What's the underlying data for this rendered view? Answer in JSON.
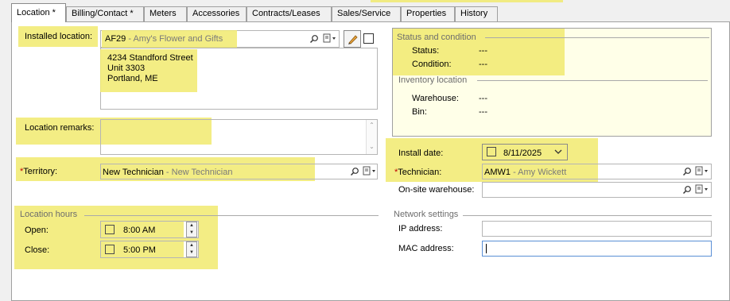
{
  "tabs": [
    {
      "label": "Location *"
    },
    {
      "label": "Billing/Contact *"
    },
    {
      "label": "Meters"
    },
    {
      "label": "Accessories"
    },
    {
      "label": "Contracts/Leases"
    },
    {
      "label": "Sales/Service"
    },
    {
      "label": "Properties"
    },
    {
      "label": "History"
    }
  ],
  "location": {
    "installed_label": "Installed location:",
    "code": "AF29",
    "name": "- Amy's Flower and Gifts",
    "address": [
      "4234 Standford Street",
      "Unit 3303",
      "Portland, ME"
    ],
    "remarks_label": "Location remarks:",
    "territory_label": "Territory:",
    "territory_code": "New Technician",
    "territory_name": "- New Technician",
    "hours_title": "Location hours",
    "open_label": "Open:",
    "open_value": "8:00 AM",
    "close_label": "Close:",
    "close_value": "5:00 PM"
  },
  "status": {
    "title": "Status and condition",
    "status_label": "Status:",
    "status_value": "---",
    "condition_label": "Condition:",
    "condition_value": "---",
    "inventory_title": "Inventory location",
    "warehouse_label": "Warehouse:",
    "warehouse_value": "---",
    "bin_label": "Bin:",
    "bin_value": "---"
  },
  "install": {
    "date_label": "Install date:",
    "date_value": "8/11/2025",
    "tech_label": "Technician:",
    "tech_code": "AMW1",
    "tech_name": "- Amy Wickett",
    "onsite_label": "On-site warehouse:"
  },
  "network": {
    "title": "Network settings",
    "ip_label": "IP address:",
    "mac_label": "MAC address:"
  },
  "colors": {
    "highlight": "#f1ea6f",
    "status_panel": "#ffffe8"
  }
}
